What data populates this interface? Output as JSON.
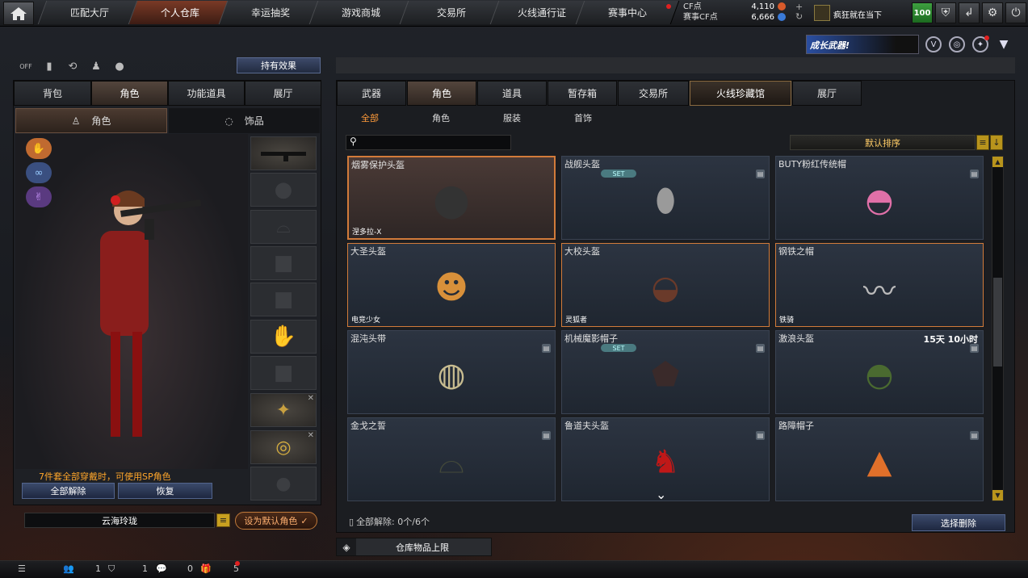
{
  "nav": {
    "tabs": [
      "匹配大厅",
      "个人仓库",
      "幸运抽奖",
      "游戏商城",
      "交易所",
      "火线通行证",
      "赛事中心"
    ],
    "active": "个人仓库",
    "cf_label": "CF点",
    "cf_value": "4,110",
    "event_cf_label": "赛事CF点",
    "event_cf_value": "6,666",
    "player_name": "疯狂就在当下",
    "level": "100"
  },
  "promo": {
    "text": "成长武器!"
  },
  "left": {
    "effects_label": "持有效果",
    "tabs": [
      "背包",
      "角色",
      "功能道具",
      "展厅"
    ],
    "active_tab": "角色",
    "subtabs": [
      "角色",
      "饰品"
    ],
    "sp_text": "7件套全部穿戴时，可使用SP角色",
    "unequip_all": "全部解除",
    "restore": "恢复",
    "char_name": "云海玲珑",
    "set_default": "设为默认角色"
  },
  "right": {
    "tabs": [
      "武器",
      "角色",
      "道具",
      "暂存箱",
      "交易所",
      "火线珍藏馆",
      "展厅"
    ],
    "active_tab": "角色",
    "special_tab": "火线珍藏馆",
    "filters": [
      "全部",
      "角色",
      "服装",
      "首饰"
    ],
    "active_filter": "全部",
    "sort_label": "默认排序",
    "items": [
      {
        "name": "烟雾保护头盔",
        "tag": "涅多拉-X",
        "selected": true,
        "icon": "helmet-icon"
      },
      {
        "name": "战舰头盔",
        "set": "SET",
        "locked": true,
        "icon": "mask-helmet-icon"
      },
      {
        "name": "BUTY粉红传统帽",
        "locked": true,
        "icon": "pink-cap-icon"
      },
      {
        "name": "大圣头盔",
        "tag": "电竞少女",
        "orange": true,
        "icon": "monkey-head-icon"
      },
      {
        "name": "大校头盔",
        "tag": "灵狐者",
        "orange": true,
        "icon": "headset-helmet-icon"
      },
      {
        "name": "钢铁之帽",
        "tag": "铁骑",
        "orange": true,
        "icon": "horn-icon"
      },
      {
        "name": "混沌头带",
        "locked": true,
        "icon": "bandage-icon"
      },
      {
        "name": "机械魔影帽子",
        "set": "SET",
        "locked": true,
        "icon": "dark-hood-icon"
      },
      {
        "name": "激浪头盔",
        "time": "15天 10小时",
        "locked": true,
        "icon": "camo-helmet-icon"
      },
      {
        "name": "金戈之誓",
        "locked": true,
        "icon": "officer-cap-icon"
      },
      {
        "name": "鲁道夫头盔",
        "locked": true,
        "icon": "reindeer-helmet-icon"
      },
      {
        "name": "路障帽子",
        "locked": true,
        "icon": "traffic-cone-icon"
      }
    ],
    "unequip_status": "全部解除: 0个/6个",
    "select_delete": "选择删除",
    "storage_limit": "仓库物品上限"
  },
  "bottom": {
    "counts": [
      "1",
      "1",
      "0",
      "5"
    ]
  },
  "colors": {
    "accent": "#d27b3a",
    "sp_text": "#ffa62a",
    "filter_active": "#ff9b3a"
  }
}
